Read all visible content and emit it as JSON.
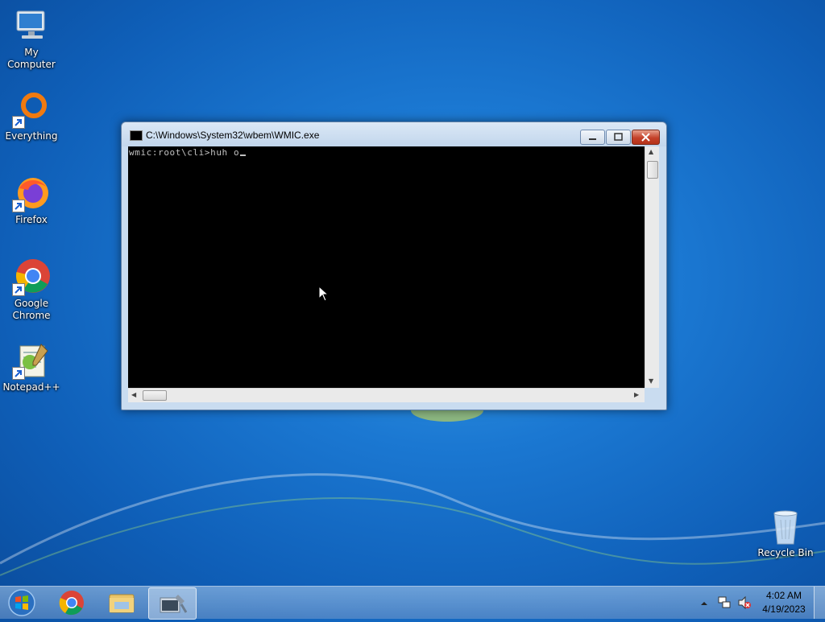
{
  "desktop": {
    "icons": [
      {
        "label": "My Computer",
        "icon": "computer-icon"
      },
      {
        "label": "Everything",
        "icon": "everything-search-icon"
      },
      {
        "label": "Firefox",
        "icon": "firefox-icon"
      },
      {
        "label": "Google Chrome",
        "icon": "chrome-icon"
      },
      {
        "label": "Notepad++",
        "icon": "notepadpp-icon"
      },
      {
        "label": "Recycle Bin",
        "icon": "recycle-bin-icon"
      }
    ]
  },
  "window": {
    "title": "C:\\Windows\\System32\\wbem\\WMIC.exe",
    "console_line": "wmic:root\\cli>huh o",
    "console_bg": "#000000",
    "console_fg": "#c0c0c0"
  },
  "taskbar": {
    "pinned": [
      {
        "name": "chrome-icon"
      },
      {
        "name": "file-explorer-icon"
      },
      {
        "name": "wmic-console-icon",
        "active": true
      }
    ],
    "tray": {
      "time": "4:02 AM",
      "date": "4/19/2023"
    }
  }
}
